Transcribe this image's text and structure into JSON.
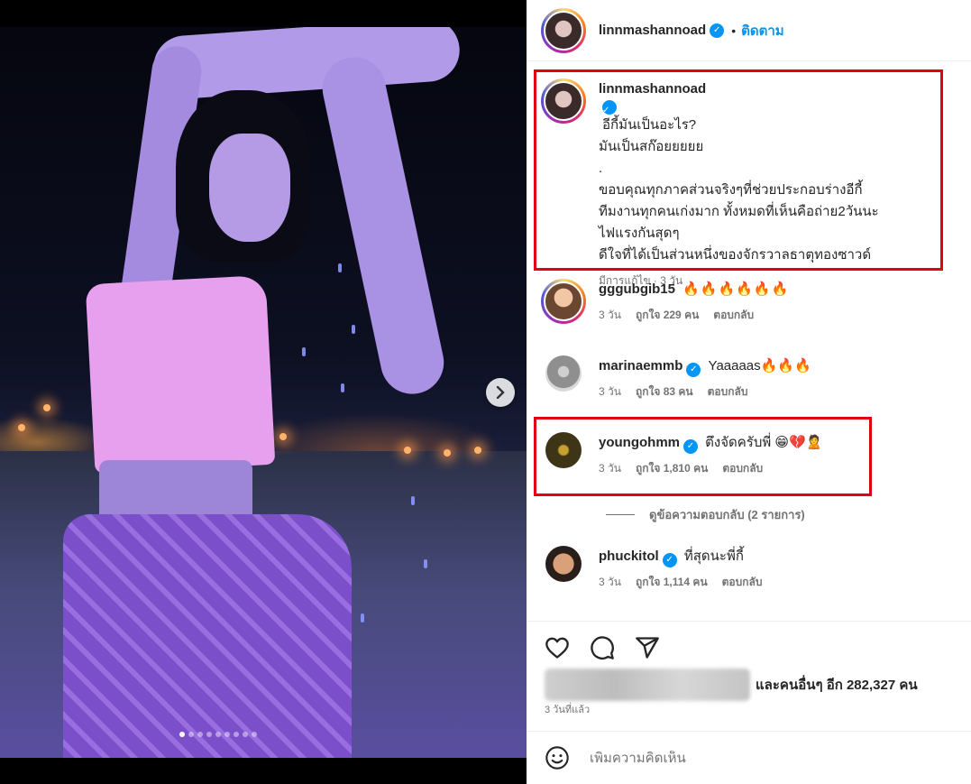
{
  "post": {
    "author": "linnmashannoad",
    "follow_label": "ติดตาม",
    "separator": "•",
    "carousel_next_icon": "chevron-right-icon",
    "carousel_dots": 9,
    "carousel_active_index": 0
  },
  "caption": {
    "username": "linnmashannoad",
    "lines": [
      "อีกี้มันเป็นอะไร?",
      "มันเป็นสก๊อยยยยย",
      ".",
      "ขอบคุณทุกภาคส่วนจริงๆที่ช่วยประกอบร่างอีกี้",
      "ทีมงานทุกคนเก่งมาก ทั้งหมดที่เห็นคือถ่าย2วันนะ",
      "ไฟแรงกันสุดๆ",
      "ดีใจที่ได้เป็นส่วนหนึ่งของจักรวาลธาตุทองซาวด์"
    ],
    "meta": "มีการแก้ไข · 3 วัน"
  },
  "comments": [
    {
      "username": "gggubgib15",
      "verified": false,
      "text": "🔥🔥🔥🔥🔥🔥",
      "time": "3 วัน",
      "likes": "ถูกใจ 229 คน",
      "reply": "ตอบกลับ"
    },
    {
      "username": "marinaemmb",
      "verified": true,
      "text": "Yaaaaas🔥🔥🔥",
      "time": "3 วัน",
      "likes": "ถูกใจ 83 คน",
      "reply": "ตอบกลับ"
    },
    {
      "username": "youngohmm",
      "verified": true,
      "text": "ตึงจัดครับพี่ 😁💔🙎",
      "time": "3 วัน",
      "likes": "ถูกใจ 1,810 คน",
      "reply": "ตอบกลับ"
    },
    {
      "username": "phuckitol",
      "verified": true,
      "text": "ที่สุดนะพี่กี้",
      "time": "3 วัน",
      "likes": "ถูกใจ 1,114 คน",
      "reply": "ตอบกลับ"
    }
  ],
  "view_replies": "ดูข้อความตอบกลับ (2 รายการ)",
  "actions": {
    "like_icon": "heart-icon",
    "comment_icon": "comment-icon",
    "share_icon": "send-icon"
  },
  "likes_summary": "และคนอื่นๆ อีก 282,327 คน",
  "time_ago": "3 วันที่แล้ว",
  "add_comment": {
    "placeholder": "เพิ่มความคิดเห็น",
    "emoji_icon": "smiley-icon"
  },
  "colors": {
    "highlight": "#e3000f",
    "link": "#0095f6",
    "verified": "#0095f6",
    "muted": "#737373"
  }
}
